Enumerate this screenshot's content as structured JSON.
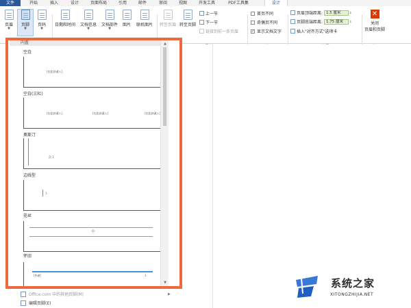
{
  "tabs": [
    "文件",
    "开始",
    "插入",
    "设计",
    "页面布局",
    "引用",
    "邮件",
    "审阅",
    "视图",
    "开发工具",
    "PDF工具集",
    "设计"
  ],
  "ribbon": {
    "header_footer_group": {
      "header": "页眉",
      "footer": "页脚",
      "page_number": "页码"
    },
    "insert_group": {
      "date_time": "日期和时间",
      "doc_info": "文档信息",
      "doc_parts": "文档部件",
      "picture": "图片",
      "online_picture": "联机图片"
    },
    "nav_group": {
      "goto_header": "转至页眉",
      "goto_footer": "转至页脚",
      "prev": "上一节",
      "next": "下一节",
      "link_prev": "链接到前一条页眉",
      "label": "导航"
    },
    "options_group": {
      "first_page": "首页不同",
      "odd_even": "奇偶页不同",
      "show_text": "显示文档文字",
      "label": "选项"
    },
    "position_group": {
      "header_top": "页眉顶端距离:",
      "header_top_value": "1.5 厘米",
      "footer_bottom": "页脚底端距离:",
      "footer_bottom_value": "1.75 厘米",
      "align_tab": "插入\"对齐方式\"选项卡",
      "label": "位置"
    },
    "close_group": {
      "close": "关闭",
      "close_hf": "页眉和页脚",
      "label": "关闭"
    }
  },
  "gallery": {
    "section": "内置",
    "templates": [
      {
        "name": "空白",
        "placeholders": [
          "[在此处键入]"
        ]
      },
      {
        "name": "空白(三栏)",
        "placeholders": [
          "[在此处键入]",
          "[在此处键入]",
          "[在此处键入]"
        ]
      },
      {
        "name": "奥斯汀",
        "placeholders": [
          "页 1"
        ]
      },
      {
        "name": "边线型",
        "placeholders": [
          "1"
        ]
      },
      {
        "name": "花丝",
        "placeholders": []
      },
      {
        "name": "怀旧",
        "placeholders": [
          "[作者]",
          "1"
        ]
      }
    ]
  },
  "menu": {
    "more_online": "Office.com 中的其他页脚(M)",
    "edit_footer": "编辑页脚(E)"
  },
  "watermark": {
    "site": "系统之家",
    "url": "XITONGZHIJIA.NET"
  },
  "colors": {
    "file_tab": "#2b579a",
    "highlight_border": "#ee6a3e",
    "accent_blue": "#4a90d9",
    "spin_green": "#e4f2d6"
  }
}
